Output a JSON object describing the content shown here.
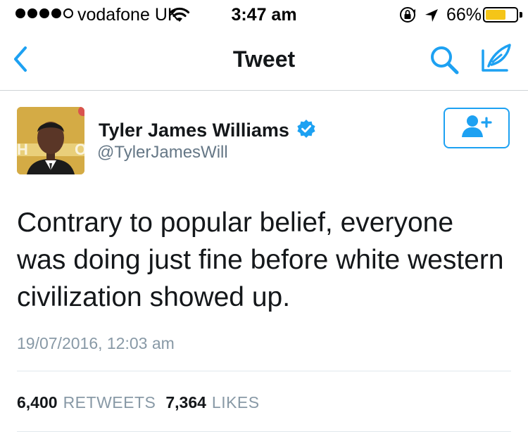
{
  "status_bar": {
    "carrier": "vodafone UK",
    "time": "3:47 am",
    "battery_percent": "66%",
    "battery_level": 0.66,
    "signal_bars_filled": 4,
    "signal_bars_total": 5,
    "icons": [
      "wifi-icon",
      "rotation-lock-icon",
      "location-arrow-icon",
      "battery-icon"
    ]
  },
  "nav": {
    "title": "Tweet",
    "back_icon": "chevron-left-icon",
    "search_icon": "search-icon",
    "compose_icon": "compose-feather-icon",
    "accent_color": "#1da1f2"
  },
  "tweet": {
    "author_name": "Tyler James Williams",
    "author_handle": "@TylerJamesWill",
    "verified": true,
    "follow_icon": "add-user-icon",
    "text": "Contrary to popular belief, everyone was doing just fine before white western civilization showed up.",
    "timestamp": "19/07/2016, 12:03 am",
    "retweet_count": "6,400",
    "retweet_label": "RETWEETS",
    "like_count": "7,364",
    "like_label": "LIKES"
  }
}
